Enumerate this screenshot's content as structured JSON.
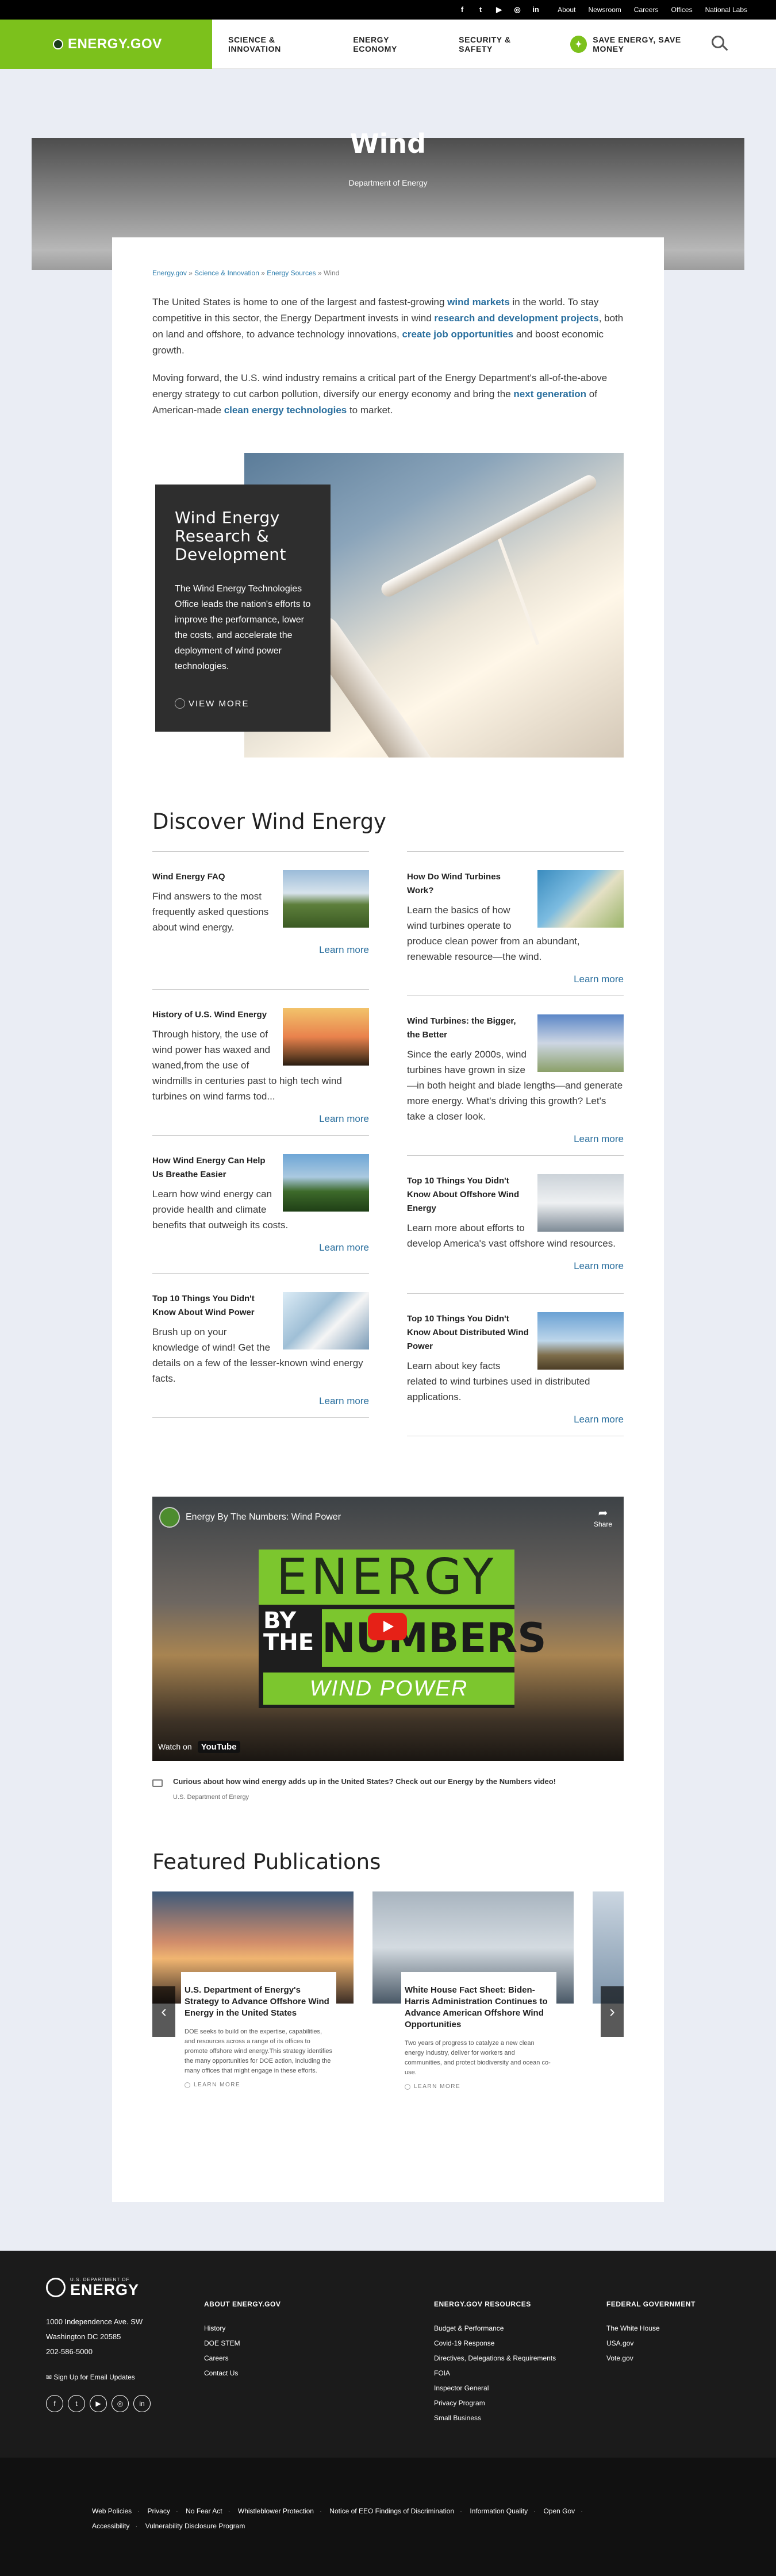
{
  "utility": {
    "social": [
      "f",
      "t",
      "▶",
      "◎",
      "in"
    ],
    "links": [
      "About",
      "Newsroom",
      "Careers",
      "Offices",
      "National Labs"
    ]
  },
  "header": {
    "logo": "ENERGY.GOV",
    "nav": [
      "SCIENCE & INNOVATION",
      "ENERGY ECONOMY",
      "SECURITY & SAFETY"
    ],
    "save": "SAVE ENERGY, SAVE MONEY"
  },
  "hero": {
    "title": "Wind",
    "subtitle": "Department of Energy"
  },
  "breadcrumb": {
    "items": [
      "Energy.gov",
      "Science & Innovation",
      "Energy Sources"
    ],
    "current": "Wind",
    "separator": " » "
  },
  "intro": {
    "p1_a": "The United States is home to one of the largest and fastest-growing ",
    "p1_link1": "wind markets",
    "p1_b": " in the world. To stay competitive in this sector, the Energy Department invests in wind ",
    "p1_link2": "research and development projects",
    "p1_c": ", both on land and offshore, to advance technology innovations, ",
    "p1_link3": "create job opportunities",
    "p1_d": " and boost economic growth.",
    "p2_a": "Moving forward, the U.S. wind industry remains a critical part of the Energy Department's all-of-the-above energy strategy to cut carbon pollution, diversify our energy economy and bring the ",
    "p2_link1": "next generation",
    "p2_b": " of American-made ",
    "p2_link2": "clean energy technologies",
    "p2_c": " to market."
  },
  "promo": {
    "title": "Wind Energy Research & Development",
    "text": "The Wind Energy Technologies Office leads the nation's efforts to improve the performance, lower the costs, and accelerate the deployment of wind power technologies.",
    "more": "VIEW MORE"
  },
  "discover": {
    "title": "Discover Wind Energy",
    "more": "Learn more",
    "left": [
      {
        "title": "Wind Energy FAQ",
        "text": "Find answers to the most frequently asked questions about wind energy."
      },
      {
        "title": "History of U.S. Wind Energy",
        "text": "Through history, the use of wind power has waxed and waned,from the use of windmills in centuries past to high tech wind turbines on wind farms tod..."
      },
      {
        "title": "How Wind Energy Can Help Us Breathe Easier",
        "text": "Learn how wind energy can provide health and climate benefits that outweigh its costs."
      },
      {
        "title": "Top 10 Things You Didn't Know About Wind Power",
        "text": "Brush up on your knowledge of wind! Get the details on a few of the lesser-known wind energy facts."
      }
    ],
    "right": [
      {
        "title": "How Do Wind Turbines Work?",
        "text": "Learn the basics of how wind turbines operate to produce clean power from an abundant, renewable resource—the wind."
      },
      {
        "title": "Wind Turbines: the Bigger, the Better",
        "text": "Since the early 2000s, wind turbines have grown in size—in both height and blade lengths—and generate more energy. What's driving this growth? Let's take a closer look."
      },
      {
        "title": "Top 10 Things You Didn't Know About Offshore Wind Energy",
        "text": "Learn more about efforts to develop America's vast offshore wind resources."
      },
      {
        "title": "Top 10 Things You Didn't Know About Distributed Wind Power",
        "text": "Learn about key facts related to wind turbines used in distributed applications."
      }
    ]
  },
  "video": {
    "title": "Energy By The Numbers: Wind Power",
    "share": "Share",
    "line1": "ENERGY",
    "by": "BY",
    "the": "THE",
    "numbers": "NUMBERS",
    "wind": "WIND POWER",
    "watch_on": "Watch on",
    "yt": "YouTube",
    "caption": "Curious about how wind energy adds up in the United States? Check out our Energy by the Numbers video!",
    "credit": "U.S. Department of Energy"
  },
  "featured": {
    "title": "Featured Publications",
    "cards": [
      {
        "title": "U.S. Department of Energy's Strategy to Advance Offshore Wind Energy in the United States",
        "text": "DOE seeks to build on the expertise, capabilities, and resources across a range of its offices to promote offshore wind energy.This strategy identifies the many opportunities for DOE action, including the many offices that might engage in these efforts.",
        "more": "LEARN MORE"
      },
      {
        "title": "White House Fact Sheet: Biden-Harris Administration Continues to Advance American Offshore Wind Opportunities",
        "text": "Two years of progress to catalyze a new clean energy industry, deliver for workers and communities, and protect biodiversity and ocean co-use.",
        "more": "LEARN MORE"
      }
    ]
  },
  "footer": {
    "dept_small": "U.S. DEPARTMENT OF",
    "dept_big": "ENERGY",
    "address": [
      "1000 Independence Ave. SW",
      "Washington DC 20585",
      "202-586-5000"
    ],
    "signup": "Sign Up for Email Updates",
    "social": [
      "f",
      "t",
      "▶",
      "◎",
      "in"
    ],
    "col1": {
      "head": "ABOUT ENERGY.GOV",
      "links": [
        "History",
        "DOE STEM",
        "Careers",
        "Contact Us"
      ]
    },
    "col2": {
      "head": "ENERGY.GOV RESOURCES",
      "links": [
        "Budget & Performance",
        "Covid-19 Response",
        "Directives, Delegations & Requirements",
        "FOIA",
        "Inspector General",
        "Privacy Program",
        "Small Business"
      ]
    },
    "col3": {
      "head": "FEDERAL GOVERNMENT",
      "links": [
        "The White House",
        "USA.gov",
        "Vote.gov"
      ]
    },
    "bottom_row1": [
      "Web Policies",
      "Privacy",
      "No Fear Act",
      "Whistleblower Protection",
      "Notice of EEO Findings of Discrimination",
      "Information Quality",
      "Open Gov"
    ],
    "bottom_row2": [
      "Accessibility",
      "Vulnerability Disclosure Program"
    ]
  },
  "colors": {
    "brand_green": "#7cc11c",
    "link_blue": "#2a6f9e",
    "footer_bg": "#1b1b1b"
  }
}
